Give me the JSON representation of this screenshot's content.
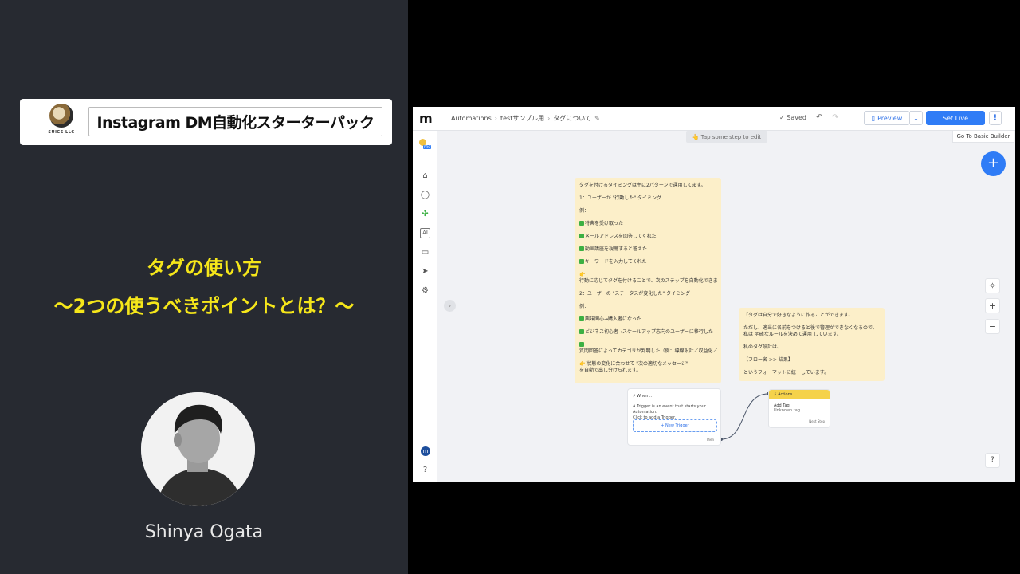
{
  "banner": {
    "logo_text": "SUICS LLC",
    "title": "Instagram DM自動化スターターパック"
  },
  "headline": {
    "line1": "タグの使い方",
    "line2": "〜2つの使うべきポイントとは？〜",
    "color": "#f5e61a"
  },
  "author": {
    "name": "Shinya Ogata"
  },
  "app": {
    "breadcrumb": [
      "Automations",
      "testサンプル用",
      "タグについて"
    ],
    "saved_label": "✓ Saved",
    "preview_label": "Preview",
    "set_live_label": "Set Live",
    "tap_hint": "👆 Tap some step to edit",
    "basic_builder_label": "Go To Basic Builder",
    "accent_color": "#2f7cf6",
    "sidebar_icons": [
      "home-icon",
      "user-icon",
      "integrations-icon",
      "ai-icon",
      "chat-icon",
      "send-icon",
      "settings-icon"
    ],
    "sidebar_badge": "PRO",
    "sidebar_avatar": "m",
    "note1": {
      "l01": "タグを付けるタイミングは主に2パターンで運用してます。",
      "l02": "1：ユーザーが \"行動した\" タイミング",
      "l03": "例：",
      "l04": "特典を受け取った",
      "l05": "メールアドレスを回答してくれた",
      "l06": "動画講座を視聴すると答えた",
      "l07": "キーワードを入力してくれた",
      "l08": "👉",
      "l09": "行動に応じてタグを付けることで、次のステップを自動化できま",
      "l10": "2：ユーザーの \"ステータスが変化した\" タイミング",
      "l11": "例：",
      "l12": "興味関心→購入者になった",
      "l13": "ビジネス初心者→スケールアップ志向のユーザーに移行した",
      "l14": "質問回答によってカテゴリが判明した（例：導線設計／収益化／",
      "l15": "👉 状態の変化に合わせて \"次の適切なメッセージ\"",
      "l16": "を自動で出し分けられます。"
    },
    "note2": {
      "l1": "「タグは自分で好きなように作ることができます。",
      "l2": "ただし、適当に名前をつけると後で管理ができなくなるので、",
      "l3": "私は 明確なルールを決めて運用 しています。",
      "l4": "私のタグ設計は、",
      "l5": "【フロー名 >> 結果】",
      "l6": "というフォーマットに統一しています。"
    },
    "trigger": {
      "header": "When...",
      "desc1": "A Trigger is an event that starts your Automation.",
      "desc2": "Click to add a Trigger.",
      "button": "+ New Trigger",
      "then": "Then"
    },
    "actions": {
      "header": "Actions",
      "line1": "Add Tag",
      "line2": "Unknown tag",
      "next": "Next Step"
    }
  }
}
